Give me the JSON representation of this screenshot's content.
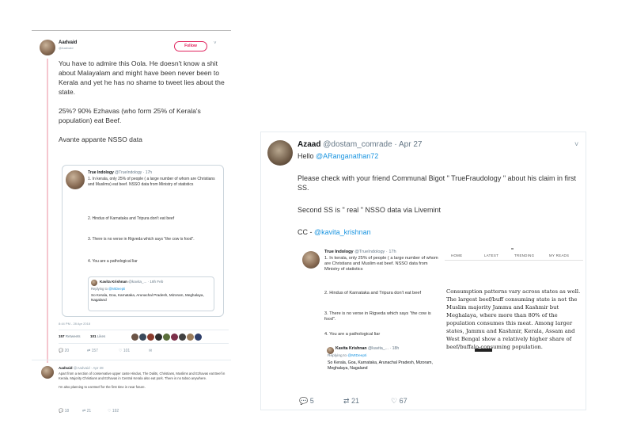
{
  "left_tweet": {
    "author_name": "Aadvaid",
    "author_handle": "@Aadvaid",
    "follow_label": "Follow",
    "chevron": "˅",
    "text": "You have to admire this Oola. He doesn't know a shit about Malayalam and might have been never been to Kerala and yet he has no shame to tweet lies about the state.\n\n25%? 90% Ezhavas (who form 25% of Kerala's population) eat Beef.\n\nAvante appante NSSO data",
    "quoted": {
      "name": "True Indology",
      "handle": "@TrueIndology · 17h",
      "p1": "1. In kerala, only 25% of people ( a large number of whom are Christians and Muslims) eat beef. NSSO data from Ministry of statistics",
      "p2": "2. Hindus of Karnataka and Tripura don't eat beef",
      "p3": "3. There is no verse in Rigveda which says \"the cow is food\".",
      "p4": "4. You are a pathological liar",
      "inner": {
        "name": "Kavita Krishnan",
        "handle": "@kavita_... · 18h Feb",
        "replying_prefix": "Replying to",
        "replying_handle": "@MIDeepti",
        "text": "So Kerala, Goa, Karnataka, Arunachal Pradesh, Mizoram, Meghalaya, Nagaland"
      }
    },
    "meta": "8:44 PM - 28 Apr 2018",
    "retweets_label": "Retweets",
    "retweets_count": "157",
    "likes_label": "Likes",
    "likes_count": "101",
    "actions": {
      "reply": "20",
      "retweet": "157",
      "like": "101",
      "dm": "✉"
    },
    "reply_tweet": {
      "name": "Aadvaid",
      "handle": "@Aadvaid · Apr 28",
      "text": "Apart from a section of conservative upper caste Hindus, The Dalits, Christians, Muslims and Ezhavas eat Beef in Kerala. Majority Christians and Ezhavas in Central Kerala also eat pork. There is no taboo anywhere.\n\nI'm also planning to eat Beef for the first time in near future.",
      "actions": {
        "reply": "18",
        "retweet": "21",
        "like": "192"
      }
    }
  },
  "right_tweet": {
    "author_name": "Azaad",
    "author_handle": "@dostam_comrade · Apr 27",
    "chevron": "˅",
    "hello_prefix": "Hello",
    "hello_mention": "@ARanganathan72",
    "line1": "Please check with your friend Communal Bigot \" TrueFraudology \" about his claim in first SS.",
    "line2": "Second SS is \" real \" NSSO data via Livemint",
    "cc_prefix": "CC -",
    "cc_mention": "@kavita_krishnan",
    "quoted": {
      "name": "True Indology",
      "handle": "@TrueIndology · 17h",
      "p1": "1. In kerala, only 25% of people ( a large number of whom are Christians and Muslim eat beef. NSSO data from Ministry of statistics",
      "p2": "2. Hindus of Karnataka and Tripura don't eat beef",
      "p3": "3. There is no verse in Rigveda which says \"the cow is food\".",
      "p4": "4. You are a pathological liar",
      "inner": {
        "name": "Kavita Krishnan",
        "handle": "@kavita_... · 18h",
        "replying_prefix": "Replying to",
        "replying_handle": "@MIDeepti",
        "text": "So Kerala, Goa, Karnataka, Arunachal Pradesh, Mizoram, Meghalaya, Nagaland"
      }
    },
    "article": {
      "nav": [
        "HOME",
        "LATEST",
        "TRENDING",
        "MY READS"
      ],
      "text": "Consumption patterns vary across states as well. The largest beef/buff consuming state is not the Muslim majority Jammu and Kashmir but Meghalaya, where more than 80% of the population consumes this meat. Among larger states, Jammu and Kashmir, Kerala, Assam and West Bengal show a relatively higher share of beef/buffalo-consuming population."
    },
    "actions": {
      "reply": "5",
      "retweet": "21",
      "like": "67"
    }
  },
  "colors": {
    "link": "#1b95e0",
    "follow": "#e0245e",
    "muted": "#657786"
  }
}
